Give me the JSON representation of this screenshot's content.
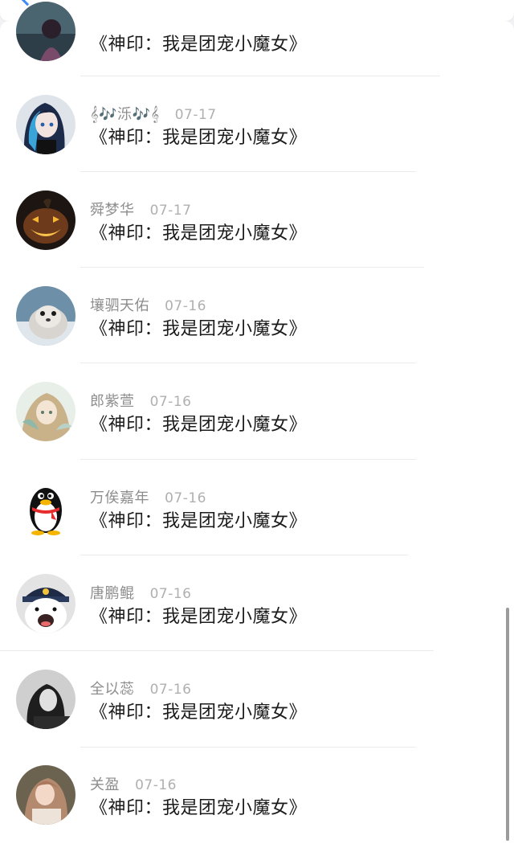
{
  "header": {
    "back_icon": "chevron-left-icon",
    "accent_color": "#3d8bf5"
  },
  "comments": [
    {
      "name": "",
      "date": "",
      "content": "《神印：我是团宠小魔女》",
      "avatar": "dark-portrait-avatar"
    },
    {
      "name": "𝄞🎶泺🎶𝄞",
      "date": "07-17",
      "content": "《神印：我是团宠小魔女》",
      "avatar": "anime-girl-avatar"
    },
    {
      "name": "舜梦华",
      "date": "07-17",
      "content": "《神印：我是团宠小魔女》",
      "avatar": "pumpkin-avatar"
    },
    {
      "name": "壤驷天佑",
      "date": "07-16",
      "content": "《神印：我是团宠小魔女》",
      "avatar": "seal-avatar"
    },
    {
      "name": "郎紫萱",
      "date": "07-16",
      "content": "《神印：我是团宠小魔女》",
      "avatar": "anime-illustration-avatar"
    },
    {
      "name": "万俟嘉年",
      "date": "07-16",
      "content": "《神印：我是团宠小魔女》",
      "avatar": "qq-penguin-avatar"
    },
    {
      "name": "唐鹏鲲",
      "date": "07-16",
      "content": "《神印：我是团宠小魔女》",
      "avatar": "cartoon-bear-avatar"
    },
    {
      "name": "全以蕊",
      "date": "07-16",
      "content": "《神印：我是团宠小魔女》",
      "avatar": "bw-portrait-avatar"
    },
    {
      "name": "关盈",
      "date": "07-16",
      "content": "《神印：我是团宠小魔女》",
      "avatar": "girl-photo-avatar"
    }
  ]
}
